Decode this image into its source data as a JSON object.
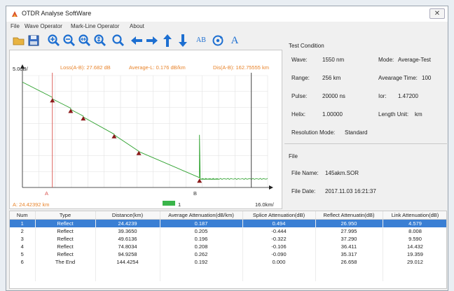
{
  "window": {
    "title": "OTDR Analyse SoftWare",
    "close_glyph": "✕"
  },
  "menu": [
    "File",
    "Wave Operator",
    "Mark-Line Operator",
    "About"
  ],
  "toolbar": {
    "icons": [
      "open-folder-icon",
      "save-icon",
      "zoom-in-icon",
      "zoom-out-icon",
      "zoom-horizontal-icon",
      "zoom-vertical-icon",
      "zoom-reset-icon",
      "arrow-left-icon",
      "arrow-right-icon",
      "arrow-up-icon",
      "arrow-down-icon",
      "marker-ab-icon",
      "refresh-icon",
      "text-a-icon"
    ],
    "ab_label": "AB",
    "a_label": "A"
  },
  "chart": {
    "y_unit": "5.0dB/",
    "x_unit": "16.0km/",
    "loss_text": "Loss(A-B): 27.682 dB",
    "avg_text": "Average-L: 0.176 dB/km",
    "dis_text": "Dis(A-B): 162.75555 km",
    "a_position_text": "A: 24.42392 km",
    "marker_a": "A",
    "marker_b": "B",
    "legend_label": "1",
    "colors": {
      "trace": "#2ca02c",
      "marker_a": "#d9534f",
      "marker_b": "#333333",
      "event": "#8b1a1a",
      "info": "#e8832a"
    }
  },
  "chart_data": {
    "type": "line",
    "title": "",
    "xlabel": "16.0km/",
    "ylabel": "5.0dB/",
    "series": [
      {
        "name": "1",
        "x": [
          0,
          24.4,
          24.4,
          39.4,
          39.4,
          49.6,
          49.6,
          74.8,
          74.8,
          94.9,
          94.9,
          144.4,
          144.4,
          145,
          160
        ],
        "y": [
          0,
          -4.6,
          -5.1,
          -7.9,
          -8.3,
          -10.3,
          -10.6,
          -15.8,
          -16.0,
          -21.0,
          -21.1,
          -29.0,
          -16.0,
          -29.5,
          -29.5
        ]
      }
    ],
    "markers": {
      "A": 24.42,
      "B": 186.7
    },
    "events_km": [
      24.4239,
      39.365,
      49.6136,
      74.8034,
      94.9258,
      144.4254
    ]
  },
  "test_condition": {
    "title": "Test Condition",
    "wave_label": "Wave:",
    "wave_value": "1550 nm",
    "mode_label": "Mode:",
    "mode_value": "Average-Test",
    "range_label": "Range:",
    "range_value": "256 km",
    "avg_time_label": "Avearage Time:",
    "avg_time_value": "100",
    "pulse_label": "Pulse:",
    "pulse_value": "20000 ns",
    "ior_label": "Ior:",
    "ior_value": "1.47200",
    "helix_label": "Helix:",
    "helix_value": "1.00000",
    "length_unit_label": "Length Unit:",
    "length_unit_value": "km",
    "resolution_label": "Resolution Mode:",
    "resolution_value": "Standard"
  },
  "file": {
    "title": "File",
    "name_label": "File Name:",
    "name_value": "145akm.SOR",
    "date_label": "File Date:",
    "date_value": "2017.11.03  16:21:37"
  },
  "events_table": {
    "columns": [
      "Num",
      "Type",
      "Distance(km)",
      "Average Attenuation(dB/km)",
      "Splice Attenuation(dB)",
      "Reflect Attenuatin(dB)",
      "Link Attenuation(dB)"
    ],
    "rows": [
      [
        "1",
        "Reflect",
        "24.4239",
        "0.187",
        "0.494",
        "26.950",
        "4.579"
      ],
      [
        "2",
        "Reflect",
        "39.3650",
        "0.205",
        "-0.444",
        "27.995",
        "8.008"
      ],
      [
        "3",
        "Reflect",
        "49.6136",
        "0.196",
        "-0.322",
        "37.290",
        "9.590"
      ],
      [
        "4",
        "Reflect",
        "74.8034",
        "0.208",
        "-0.106",
        "36.411",
        "14.432"
      ],
      [
        "5",
        "Reflect",
        "94.9258",
        "0.262",
        "-0.090",
        "35.317",
        "19.359"
      ],
      [
        "6",
        "The End",
        "144.4254",
        "0.192",
        "0.000",
        "26.658",
        "29.012"
      ]
    ],
    "selected_row": 0
  }
}
